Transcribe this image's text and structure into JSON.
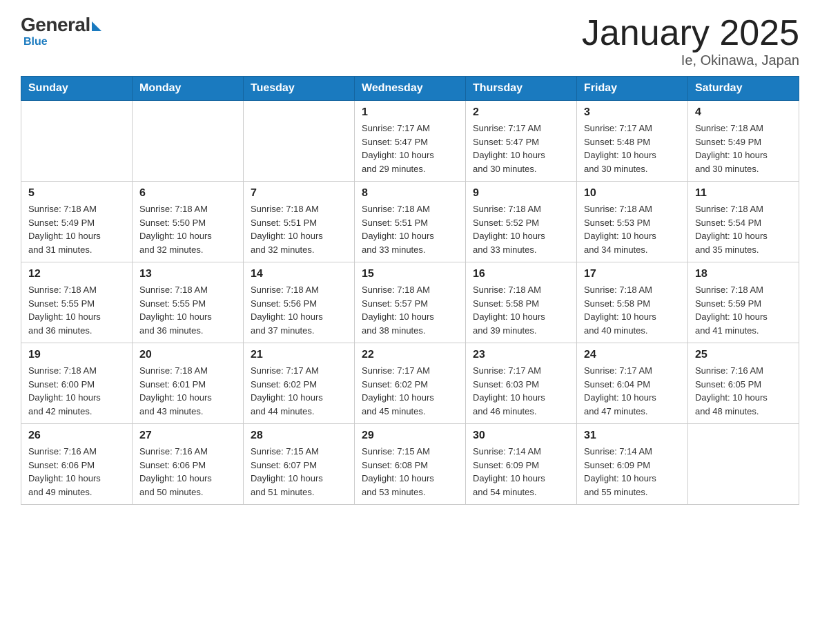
{
  "logo": {
    "general": "General",
    "blue": "Blue",
    "tagline": "Blue"
  },
  "header": {
    "title": "January 2025",
    "subtitle": "Ie, Okinawa, Japan"
  },
  "weekdays": [
    "Sunday",
    "Monday",
    "Tuesday",
    "Wednesday",
    "Thursday",
    "Friday",
    "Saturday"
  ],
  "weeks": [
    [
      {
        "day": "",
        "info": ""
      },
      {
        "day": "",
        "info": ""
      },
      {
        "day": "",
        "info": ""
      },
      {
        "day": "1",
        "info": "Sunrise: 7:17 AM\nSunset: 5:47 PM\nDaylight: 10 hours\nand 29 minutes."
      },
      {
        "day": "2",
        "info": "Sunrise: 7:17 AM\nSunset: 5:47 PM\nDaylight: 10 hours\nand 30 minutes."
      },
      {
        "day": "3",
        "info": "Sunrise: 7:17 AM\nSunset: 5:48 PM\nDaylight: 10 hours\nand 30 minutes."
      },
      {
        "day": "4",
        "info": "Sunrise: 7:18 AM\nSunset: 5:49 PM\nDaylight: 10 hours\nand 30 minutes."
      }
    ],
    [
      {
        "day": "5",
        "info": "Sunrise: 7:18 AM\nSunset: 5:49 PM\nDaylight: 10 hours\nand 31 minutes."
      },
      {
        "day": "6",
        "info": "Sunrise: 7:18 AM\nSunset: 5:50 PM\nDaylight: 10 hours\nand 32 minutes."
      },
      {
        "day": "7",
        "info": "Sunrise: 7:18 AM\nSunset: 5:51 PM\nDaylight: 10 hours\nand 32 minutes."
      },
      {
        "day": "8",
        "info": "Sunrise: 7:18 AM\nSunset: 5:51 PM\nDaylight: 10 hours\nand 33 minutes."
      },
      {
        "day": "9",
        "info": "Sunrise: 7:18 AM\nSunset: 5:52 PM\nDaylight: 10 hours\nand 33 minutes."
      },
      {
        "day": "10",
        "info": "Sunrise: 7:18 AM\nSunset: 5:53 PM\nDaylight: 10 hours\nand 34 minutes."
      },
      {
        "day": "11",
        "info": "Sunrise: 7:18 AM\nSunset: 5:54 PM\nDaylight: 10 hours\nand 35 minutes."
      }
    ],
    [
      {
        "day": "12",
        "info": "Sunrise: 7:18 AM\nSunset: 5:55 PM\nDaylight: 10 hours\nand 36 minutes."
      },
      {
        "day": "13",
        "info": "Sunrise: 7:18 AM\nSunset: 5:55 PM\nDaylight: 10 hours\nand 36 minutes."
      },
      {
        "day": "14",
        "info": "Sunrise: 7:18 AM\nSunset: 5:56 PM\nDaylight: 10 hours\nand 37 minutes."
      },
      {
        "day": "15",
        "info": "Sunrise: 7:18 AM\nSunset: 5:57 PM\nDaylight: 10 hours\nand 38 minutes."
      },
      {
        "day": "16",
        "info": "Sunrise: 7:18 AM\nSunset: 5:58 PM\nDaylight: 10 hours\nand 39 minutes."
      },
      {
        "day": "17",
        "info": "Sunrise: 7:18 AM\nSunset: 5:58 PM\nDaylight: 10 hours\nand 40 minutes."
      },
      {
        "day": "18",
        "info": "Sunrise: 7:18 AM\nSunset: 5:59 PM\nDaylight: 10 hours\nand 41 minutes."
      }
    ],
    [
      {
        "day": "19",
        "info": "Sunrise: 7:18 AM\nSunset: 6:00 PM\nDaylight: 10 hours\nand 42 minutes."
      },
      {
        "day": "20",
        "info": "Sunrise: 7:18 AM\nSunset: 6:01 PM\nDaylight: 10 hours\nand 43 minutes."
      },
      {
        "day": "21",
        "info": "Sunrise: 7:17 AM\nSunset: 6:02 PM\nDaylight: 10 hours\nand 44 minutes."
      },
      {
        "day": "22",
        "info": "Sunrise: 7:17 AM\nSunset: 6:02 PM\nDaylight: 10 hours\nand 45 minutes."
      },
      {
        "day": "23",
        "info": "Sunrise: 7:17 AM\nSunset: 6:03 PM\nDaylight: 10 hours\nand 46 minutes."
      },
      {
        "day": "24",
        "info": "Sunrise: 7:17 AM\nSunset: 6:04 PM\nDaylight: 10 hours\nand 47 minutes."
      },
      {
        "day": "25",
        "info": "Sunrise: 7:16 AM\nSunset: 6:05 PM\nDaylight: 10 hours\nand 48 minutes."
      }
    ],
    [
      {
        "day": "26",
        "info": "Sunrise: 7:16 AM\nSunset: 6:06 PM\nDaylight: 10 hours\nand 49 minutes."
      },
      {
        "day": "27",
        "info": "Sunrise: 7:16 AM\nSunset: 6:06 PM\nDaylight: 10 hours\nand 50 minutes."
      },
      {
        "day": "28",
        "info": "Sunrise: 7:15 AM\nSunset: 6:07 PM\nDaylight: 10 hours\nand 51 minutes."
      },
      {
        "day": "29",
        "info": "Sunrise: 7:15 AM\nSunset: 6:08 PM\nDaylight: 10 hours\nand 53 minutes."
      },
      {
        "day": "30",
        "info": "Sunrise: 7:14 AM\nSunset: 6:09 PM\nDaylight: 10 hours\nand 54 minutes."
      },
      {
        "day": "31",
        "info": "Sunrise: 7:14 AM\nSunset: 6:09 PM\nDaylight: 10 hours\nand 55 minutes."
      },
      {
        "day": "",
        "info": ""
      }
    ]
  ]
}
